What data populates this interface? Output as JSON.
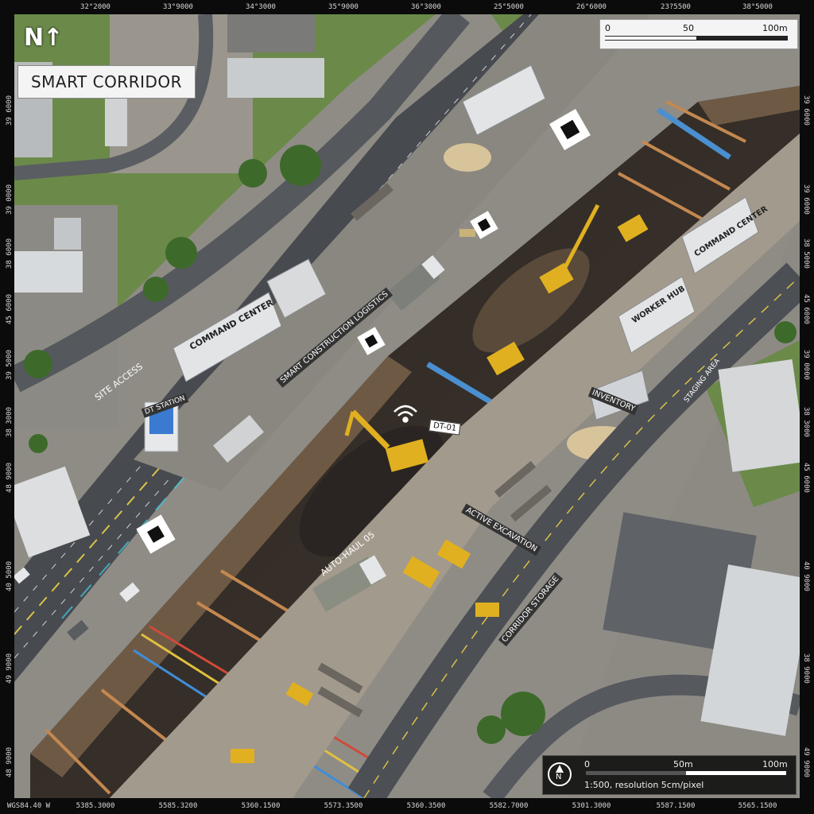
{
  "map": {
    "title": "SMART CORRIDOR",
    "north_label": "N",
    "colors": {
      "frame": "#0b0b0c",
      "asphalt": "#4a4d52",
      "grass": "#5f8a3a",
      "soil": "#3a3430",
      "excavator": "#e0b020",
      "pipe": "#3f8ed8"
    },
    "coordinates": {
      "top": [
        "32°2000",
        "33°9000",
        "34°3000",
        "35°9000",
        "36°3000",
        "25°5000",
        "26°6000",
        "23?5500",
        "38°5000"
      ],
      "bottom": [
        "WGS84.40 W",
        "5385.3000",
        "5585.3200",
        "5360.1500",
        "5573.3500",
        "5360.3500",
        "5582.7000",
        "5301.3000",
        "5587.1500",
        "5565.1500"
      ],
      "left": [
        "39 6000",
        "39 0000",
        "38 6000",
        "45 6000",
        "39 5000",
        "38 3000",
        "48 9000",
        "40 5000",
        "49 9000",
        "48 9000"
      ],
      "right": [
        "39 6000",
        "39 6000",
        "38 5000",
        "45 6000",
        "39 0000",
        "38 3000",
        "45 6000",
        "40 9000",
        "38 9000",
        "49 9000"
      ]
    },
    "scale_top": {
      "ticks": [
        "0",
        "50",
        "100m"
      ]
    },
    "scale_bottom": {
      "ticks": [
        "0",
        "50m",
        "100m"
      ],
      "text": "1:500, resolution 5cm/pixel",
      "north": "N"
    },
    "labels": [
      {
        "id": "command-center-left",
        "text": "COMMAND CENTER"
      },
      {
        "id": "command-center-right",
        "text": "COMMAND CENTER"
      },
      {
        "id": "worker-hub",
        "text": "WORKER HUB"
      },
      {
        "id": "inventory",
        "text": "INVENTORY"
      },
      {
        "id": "dt01",
        "text": "DT-01"
      },
      {
        "id": "logistics",
        "text": "SMART CONSTRUCTION LOGISTICS"
      },
      {
        "id": "active-excavation",
        "text": "ACTIVE EXCAVATION"
      },
      {
        "id": "auto-haul",
        "text": "AUTO-HAUL 05"
      },
      {
        "id": "site-access",
        "text": "SITE ACCESS"
      },
      {
        "id": "corridor-storage",
        "text": "CORRIDOR STORAGE"
      },
      {
        "id": "staging-area",
        "text": "STAGING AREA"
      },
      {
        "id": "dt-station",
        "text": "DT STATION"
      }
    ]
  }
}
